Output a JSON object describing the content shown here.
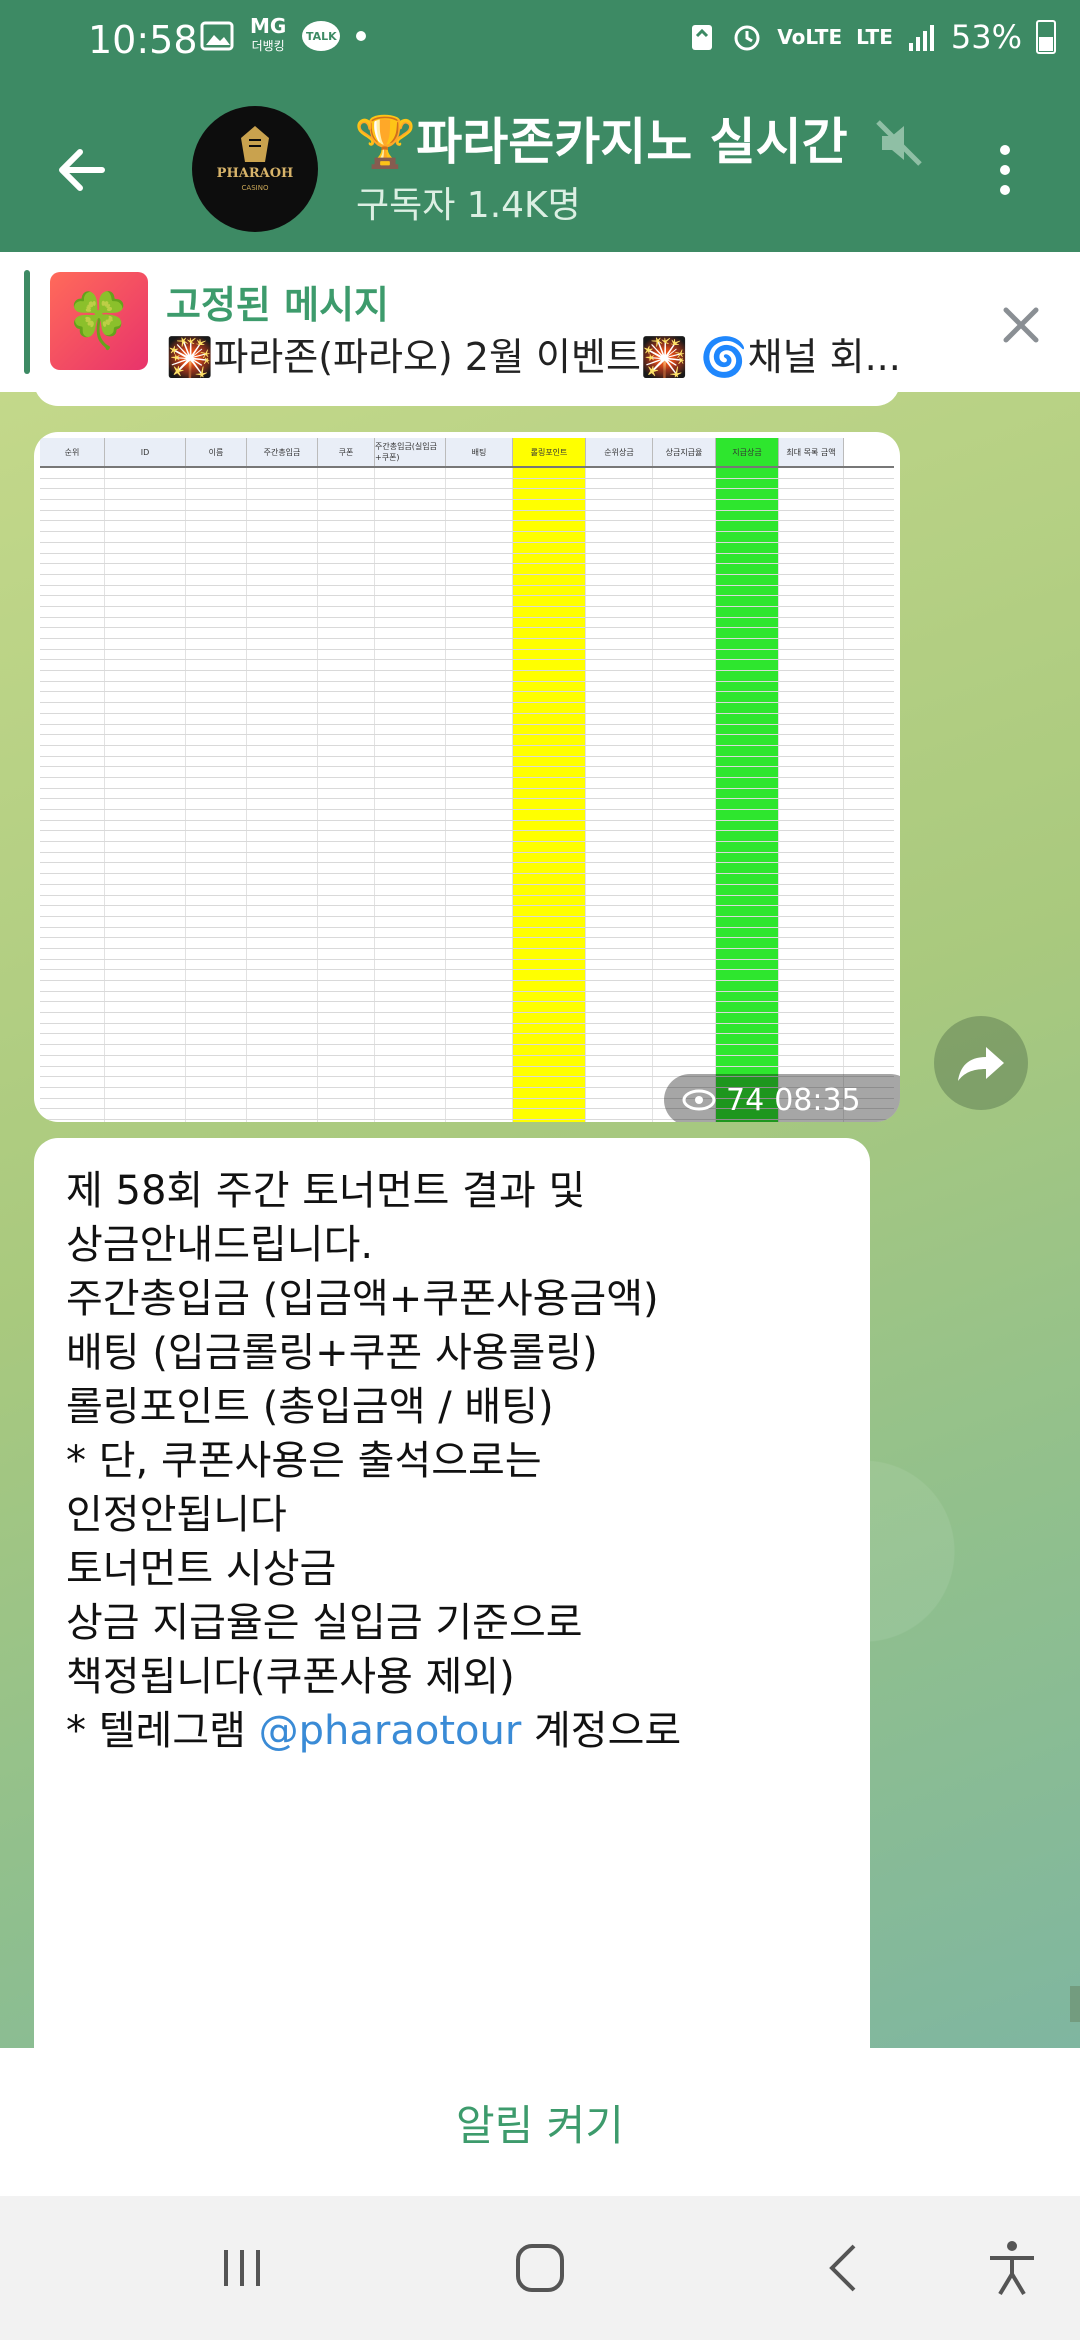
{
  "status_bar": {
    "time": "10:58",
    "mg_line1": "MG",
    "mg_line2": "더뱅킹",
    "talk": "TALK",
    "volte": "VoLTE",
    "lte": "LTE",
    "battery": "53%"
  },
  "header": {
    "title": "🏆파라존카지노 실시간",
    "subscribers": "구독자 1.4K명",
    "avatar_text": "PHARAOH",
    "avatar_sub": "CASINO"
  },
  "pinned": {
    "label": "고정된 메시지",
    "text": "🎇파라존(파라오) 2월 이벤트🎇 🌀채널 회..."
  },
  "photo_message": {
    "views": "74",
    "time": "08:35",
    "sheet_headers": [
      "순위",
      "ID",
      "이름",
      "주간총입금",
      "쿠폰",
      "주간총입금(실입금+쿠폰)",
      "배팅",
      "롤링포인트",
      "순위상금",
      "상금지급율",
      "지급상금",
      "최대 목록 금액"
    ]
  },
  "text_message": {
    "lines": [
      "제 58회 주간 토너먼트 결과 및",
      "상금안내드립니다.",
      "",
      "주간총입금 (입금액+쿠폰사용금액)",
      "배팅 (입금롤링+쿠폰 사용롤링)",
      "롤링포인트 (총입금액 / 배팅)",
      "",
      "* 단, 쿠폰사용은 출석으로는",
      "인정안됩니다",
      "",
      "토너먼트 시상금",
      "",
      "상금 지급율은 실입금 기준으로",
      "책정됩니다(쿠폰사용 제외)",
      ""
    ],
    "last_line_prefix": "* 텔레그램 ",
    "last_line_mention": "@pharaotour",
    "last_line_suffix": " 계정으로"
  },
  "bottom": {
    "notify_label": "알림 켜기"
  }
}
